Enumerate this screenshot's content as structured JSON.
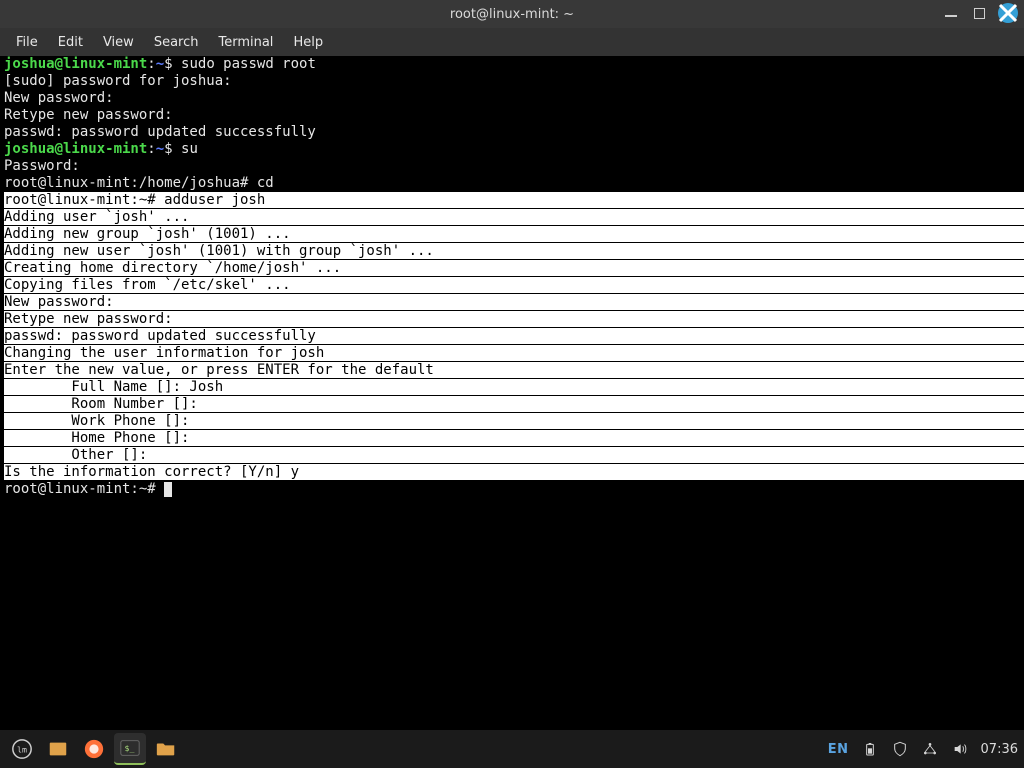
{
  "window": {
    "title": "root@linux-mint: ~"
  },
  "menu": {
    "file": "File",
    "edit": "Edit",
    "view": "View",
    "search": "Search",
    "terminal": "Terminal",
    "help": "Help"
  },
  "term": {
    "p1_user": "joshua@linux-mint",
    "p1_colon": ":",
    "p1_path": "~",
    "p1_dollar": "$ ",
    "p1_cmd": "sudo passwd root",
    "l2": "[sudo] password for joshua:",
    "l3": "New password:",
    "l4": "Retype new password:",
    "l5": "passwd: password updated successfully",
    "p2_user": "joshua@linux-mint",
    "p2_colon": ":",
    "p2_path": "~",
    "p2_dollar": "$ ",
    "p2_cmd": "su",
    "l7": "Password:",
    "l8": "root@linux-mint:/home/joshua# cd",
    "inv_prompt": "root@linux-mint:~# adduser josh",
    "inv_l1": "Adding user `josh' ...",
    "inv_l2": "Adding new group `josh' (1001) ...",
    "inv_l3": "Adding new user `josh' (1001) with group `josh' ...",
    "inv_l4": "Creating home directory `/home/josh' ...",
    "inv_l5": "Copying files from `/etc/skel' ...",
    "inv_l6": "New password:",
    "inv_l7": "Retype new password:",
    "inv_l8": "passwd: password updated successfully",
    "inv_l9": "Changing the user information for josh",
    "inv_l10": "Enter the new value, or press ENTER for the default",
    "inv_l11": "        Full Name []: Josh",
    "inv_l12": "        Room Number []:",
    "inv_l13": "        Work Phone []:",
    "inv_l14": "        Home Phone []:",
    "inv_l15": "        Other []:",
    "inv_l16": "Is the information correct? [Y/n] y",
    "final_prompt": "root@linux-mint:~# "
  },
  "taskbar": {
    "lang": "EN",
    "clock": "07:36"
  }
}
